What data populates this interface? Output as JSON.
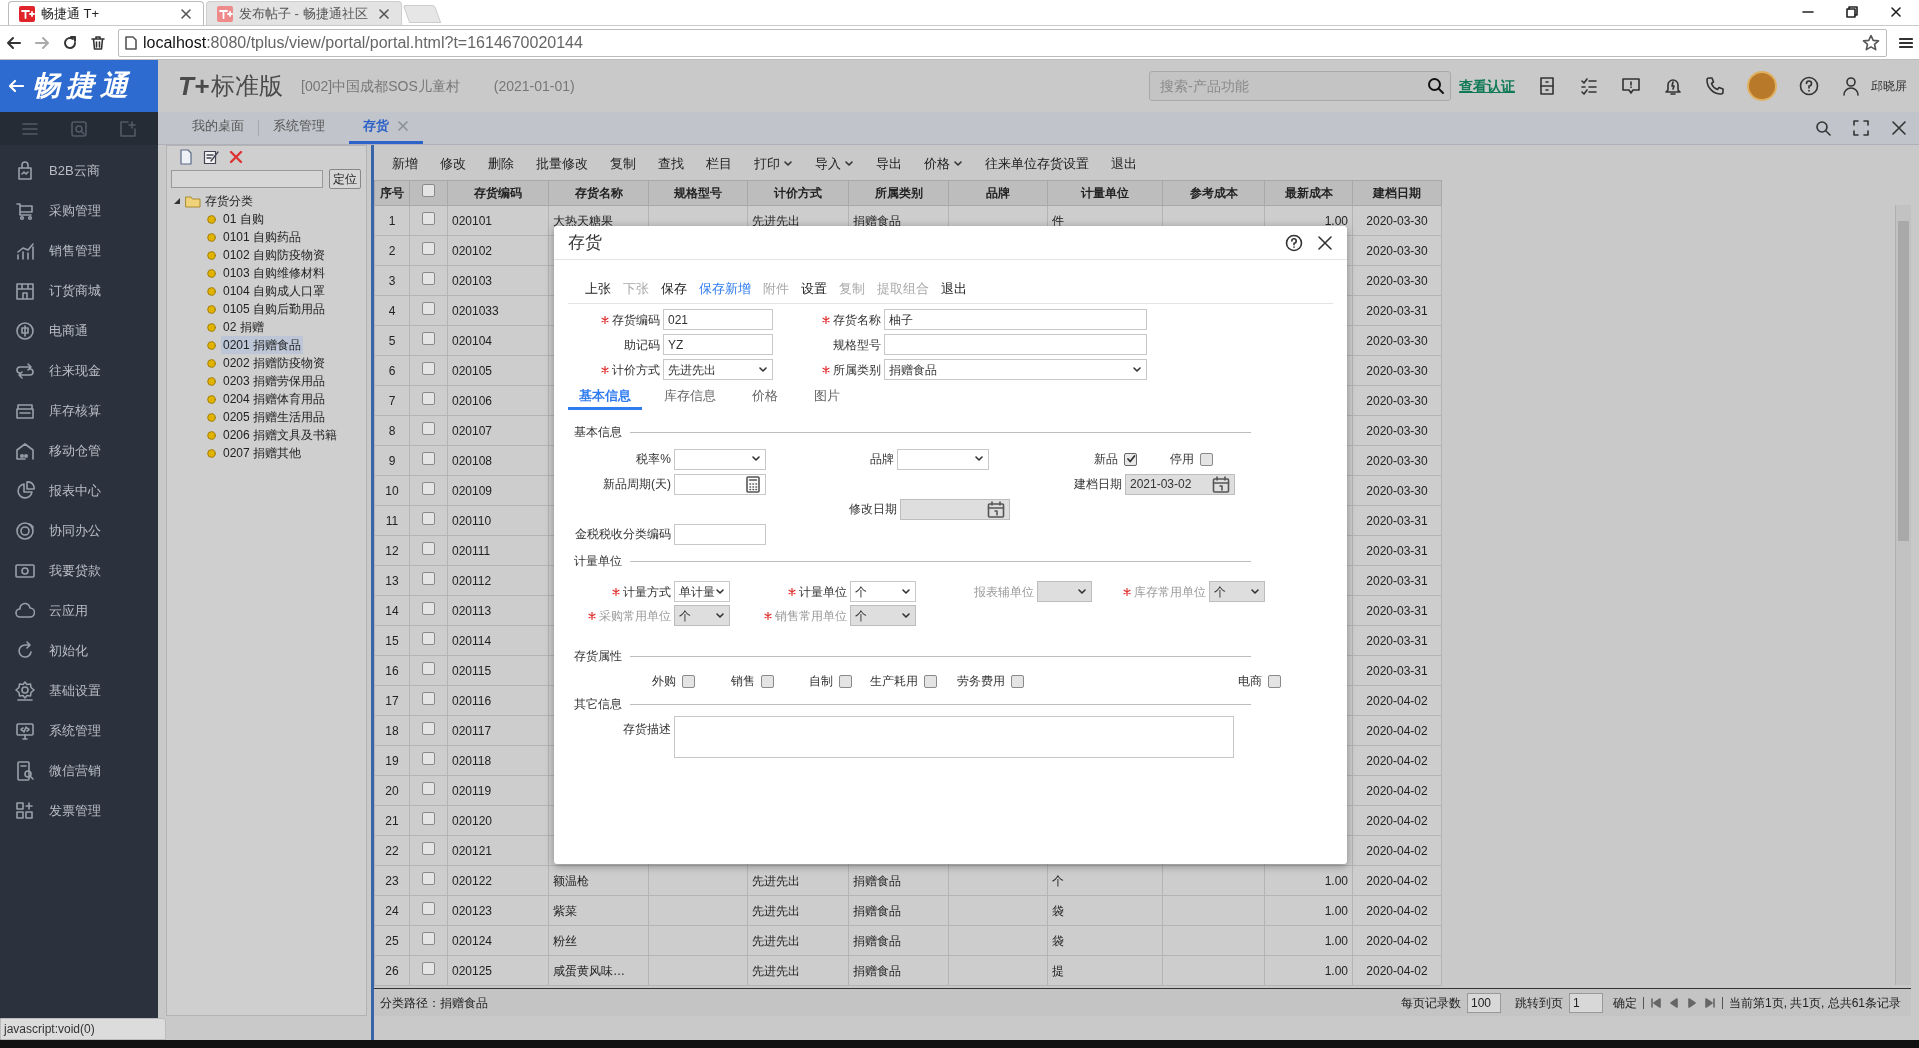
{
  "browser": {
    "tabs": [
      {
        "title": "畅捷通 T+",
        "selected": true
      },
      {
        "title": "发布帖子 - 畅捷通社区",
        "selected": false
      }
    ],
    "url_host": "localhost",
    "url_path": ":8080/tplus/view/portal/portal.html?t=1614670020144"
  },
  "header": {
    "brand": "畅捷通",
    "product_mark": "T+",
    "product": "标准版",
    "company": "[002]中国成都SOS儿童村",
    "period": "(2021-01-01)",
    "search_placeholder": "搜索-产品功能",
    "auth_link": "查看认证",
    "user": "邱晓屏"
  },
  "sidebar": {
    "items": [
      {
        "label": "B2B云商"
      },
      {
        "label": "采购管理"
      },
      {
        "label": "销售管理"
      },
      {
        "label": "订货商城"
      },
      {
        "label": "电商通"
      },
      {
        "label": "往来现金"
      },
      {
        "label": "库存核算"
      },
      {
        "label": "移动仓管"
      },
      {
        "label": "报表中心"
      },
      {
        "label": "协同办公"
      },
      {
        "label": "我要贷款"
      },
      {
        "label": "云应用"
      },
      {
        "label": "初始化"
      },
      {
        "label": "基础设置"
      },
      {
        "label": "系统管理"
      },
      {
        "label": "微信营销"
      },
      {
        "label": "发票管理"
      }
    ]
  },
  "page_tabs": [
    {
      "label": "我的桌面",
      "selected": false
    },
    {
      "label": "系统管理",
      "selected": false
    },
    {
      "label": "存货",
      "selected": true
    }
  ],
  "tree": {
    "locate_button": "定位",
    "root": {
      "label": "存货分类",
      "expanded": true,
      "children": [
        {
          "label": "01 自购",
          "selected": false
        },
        {
          "label": "0101 自购药品",
          "selected": false
        },
        {
          "label": "0102 自购防疫物资",
          "selected": false
        },
        {
          "label": "0103 自购维修材料",
          "selected": false
        },
        {
          "label": "0104 自购成人口罩",
          "selected": false
        },
        {
          "label": "0105 自购后勤用品",
          "selected": false
        },
        {
          "label": "02 捐赠",
          "selected": false
        },
        {
          "label": "0201 捐赠食品",
          "selected": true
        },
        {
          "label": "0202 捐赠防疫物资",
          "selected": false
        },
        {
          "label": "0203 捐赠劳保用品",
          "selected": false
        },
        {
          "label": "0204 捐赠体育用品",
          "selected": false
        },
        {
          "label": "0205 捐赠生活用品",
          "selected": false
        },
        {
          "label": "0206 捐赠文具及书籍",
          "selected": false
        },
        {
          "label": "0207 捐赠其他",
          "selected": false
        }
      ]
    }
  },
  "toolbar": [
    {
      "label": "新增",
      "dropdown": false
    },
    {
      "label": "修改",
      "dropdown": false
    },
    {
      "label": "删除",
      "dropdown": false
    },
    {
      "label": "批量修改",
      "dropdown": false
    },
    {
      "label": "复制",
      "dropdown": false
    },
    {
      "label": "查找",
      "dropdown": false
    },
    {
      "label": "栏目",
      "dropdown": false
    },
    {
      "label": "打印",
      "dropdown": true
    },
    {
      "label": "导入",
      "dropdown": true
    },
    {
      "label": "导出",
      "dropdown": false
    },
    {
      "label": "价格",
      "dropdown": true
    },
    {
      "label": "往来单位存货设置",
      "dropdown": false
    },
    {
      "label": "退出",
      "dropdown": false
    }
  ],
  "table": {
    "columns": [
      {
        "kind": "text",
        "label": "序号"
      },
      {
        "kind": "checkbox",
        "checked": false
      },
      {
        "kind": "text",
        "label": "存货编码"
      },
      {
        "kind": "text",
        "label": "存货名称"
      },
      {
        "kind": "text",
        "label": "规格型号"
      },
      {
        "kind": "text",
        "label": "计价方式"
      },
      {
        "kind": "text",
        "label": "所属类别"
      },
      {
        "kind": "text",
        "label": "品牌"
      },
      {
        "kind": "text",
        "label": "计量单位"
      },
      {
        "kind": "text",
        "label": "参考成本"
      },
      {
        "kind": "text",
        "label": "最新成本"
      },
      {
        "kind": "text",
        "label": "建档日期"
      }
    ],
    "rows": [
      {
        "no": "1",
        "checked": false,
        "code": "020101",
        "name": "大热天糖果",
        "pricing": "先进先出",
        "category": "捐赠食品",
        "unit": "件",
        "latest_cost": "1.00",
        "created": "2020-03-30"
      },
      {
        "no": "2",
        "checked": false,
        "code": "020102",
        "created": "2020-03-30"
      },
      {
        "no": "3",
        "checked": false,
        "code": "020103",
        "created": "2020-03-30"
      },
      {
        "no": "4",
        "checked": false,
        "code": "0201033",
        "created": "2020-03-31"
      },
      {
        "no": "5",
        "checked": false,
        "code": "020104",
        "created": "2020-03-30"
      },
      {
        "no": "6",
        "checked": false,
        "code": "020105",
        "created": "2020-03-30"
      },
      {
        "no": "7",
        "checked": false,
        "code": "020106",
        "created": "2020-03-30"
      },
      {
        "no": "8",
        "checked": false,
        "code": "020107",
        "created": "2020-03-30"
      },
      {
        "no": "9",
        "checked": false,
        "code": "020108",
        "created": "2020-03-30"
      },
      {
        "no": "10",
        "checked": false,
        "code": "020109",
        "created": "2020-03-30"
      },
      {
        "no": "11",
        "checked": false,
        "code": "020110",
        "created": "2020-03-31"
      },
      {
        "no": "12",
        "checked": false,
        "code": "020111",
        "created": "2020-03-31"
      },
      {
        "no": "13",
        "checked": false,
        "code": "020112",
        "created": "2020-03-31"
      },
      {
        "no": "14",
        "checked": false,
        "code": "020113",
        "created": "2020-03-31"
      },
      {
        "no": "15",
        "checked": false,
        "code": "020114",
        "created": "2020-03-31"
      },
      {
        "no": "16",
        "checked": false,
        "code": "020115",
        "created": "2020-03-31"
      },
      {
        "no": "17",
        "checked": false,
        "code": "020116",
        "created": "2020-04-02"
      },
      {
        "no": "18",
        "checked": false,
        "code": "020117",
        "created": "2020-04-02"
      },
      {
        "no": "19",
        "checked": false,
        "code": "020118",
        "created": "2020-04-02"
      },
      {
        "no": "20",
        "checked": false,
        "code": "020119",
        "created": "2020-04-02"
      },
      {
        "no": "21",
        "checked": false,
        "code": "020120",
        "created": "2020-04-02"
      },
      {
        "no": "22",
        "checked": false,
        "code": "020121",
        "created": "2020-04-02"
      },
      {
        "no": "23",
        "checked": false,
        "code": "020122",
        "name": "额温枪",
        "pricing": "先进先出",
        "category": "捐赠食品",
        "unit": "个",
        "latest_cost": "1.00",
        "created": "2020-04-02"
      },
      {
        "no": "24",
        "checked": false,
        "code": "020123",
        "name": "紫菜",
        "pricing": "先进先出",
        "category": "捐赠食品",
        "unit": "袋",
        "latest_cost": "1.00",
        "created": "2020-04-02"
      },
      {
        "no": "25",
        "checked": false,
        "code": "020124",
        "name": "粉丝",
        "pricing": "先进先出",
        "category": "捐赠食品",
        "unit": "袋",
        "latest_cost": "1.00",
        "created": "2020-04-02"
      },
      {
        "no": "26",
        "checked": false,
        "code": "020125",
        "name": "咸蛋黄风味…",
        "pricing": "先进先出",
        "category": "捐赠食品",
        "unit": "提",
        "latest_cost": "1.00",
        "created": "2020-04-02"
      }
    ]
  },
  "footer": {
    "path": "分类路径：捐赠食品",
    "page_size_label": "每页记录数",
    "page_size": "100",
    "jump_label": "跳转到页",
    "jump_page": "1",
    "confirm": "确定",
    "summary": "当前第1页, 共1页, 总共61条记录"
  },
  "status_bar": "javascript:void(0)",
  "dialog": {
    "title": "存货",
    "toolbar": [
      {
        "label": "上张",
        "disabled": false,
        "accent": false
      },
      {
        "label": "下张",
        "disabled": true,
        "accent": false
      },
      {
        "label": "保存",
        "disabled": false,
        "accent": false
      },
      {
        "label": "保存新增",
        "disabled": false,
        "accent": true
      },
      {
        "label": "附件",
        "disabled": true,
        "accent": false
      },
      {
        "label": "设置",
        "disabled": false,
        "accent": false
      },
      {
        "label": "复制",
        "disabled": true,
        "accent": false
      },
      {
        "label": "提取组合",
        "disabled": true,
        "accent": false
      },
      {
        "label": "退出",
        "disabled": false,
        "accent": false
      }
    ],
    "fields": [
      {
        "label": "存货编码",
        "required": true,
        "kind": "text",
        "value": "021"
      },
      {
        "label": "存货名称",
        "required": true,
        "kind": "text",
        "value": "柚子"
      },
      {
        "label": "助记码",
        "required": false,
        "kind": "text",
        "value": "YZ"
      },
      {
        "label": "规格型号",
        "required": false,
        "kind": "text"
      },
      {
        "label": "计价方式",
        "required": true,
        "kind": "select",
        "value": "先进先出"
      },
      {
        "label": "所属类别",
        "required": true,
        "kind": "select",
        "value": "捐赠食品"
      }
    ],
    "tabs": [
      {
        "label": "基本信息",
        "selected": true
      },
      {
        "label": "库存信息",
        "selected": false
      },
      {
        "label": "价格",
        "selected": false
      },
      {
        "label": "图片",
        "selected": false
      }
    ],
    "basic": {
      "title": "基本信息",
      "tax_rate": {
        "label": "税率%"
      },
      "brand": {
        "label": "品牌"
      },
      "new_item": {
        "label": "新品",
        "checked": true
      },
      "stopped": {
        "label": "停用",
        "checked": false
      },
      "new_period": {
        "label": "新品周期(天)"
      },
      "created": {
        "label": "建档日期",
        "value": "2021-03-02"
      },
      "modified": {
        "label": "修改日期",
        "disabled": true
      },
      "tax_code": {
        "label": "金税税收分类编码"
      }
    },
    "units": {
      "title": "计量单位",
      "fields": [
        {
          "label": "计量方式",
          "required": true,
          "value": "单计量",
          "disabled": false
        },
        {
          "label": "计量单位",
          "required": true,
          "value": "个",
          "disabled": false
        },
        {
          "label": "报表辅单位",
          "required": false,
          "disabled": true
        },
        {
          "label": "库存常用单位",
          "required": true,
          "value": "个",
          "disabled": true
        },
        {
          "label": "采购常用单位",
          "required": true,
          "value": "个",
          "disabled": true
        },
        {
          "label": "销售常用单位",
          "required": true,
          "value": "个",
          "disabled": true
        }
      ]
    },
    "attributes": {
      "title": "存货属性",
      "items": [
        {
          "label": "外购",
          "checked": false
        },
        {
          "label": "销售",
          "checked": false
        },
        {
          "label": "自制",
          "checked": false
        },
        {
          "label": "生产耗用",
          "checked": false
        },
        {
          "label": "劳务费用",
          "checked": false
        },
        {
          "label": "电商",
          "checked": false
        }
      ]
    },
    "other": {
      "title": "其它信息",
      "description": {
        "label": "存货描述"
      }
    }
  }
}
